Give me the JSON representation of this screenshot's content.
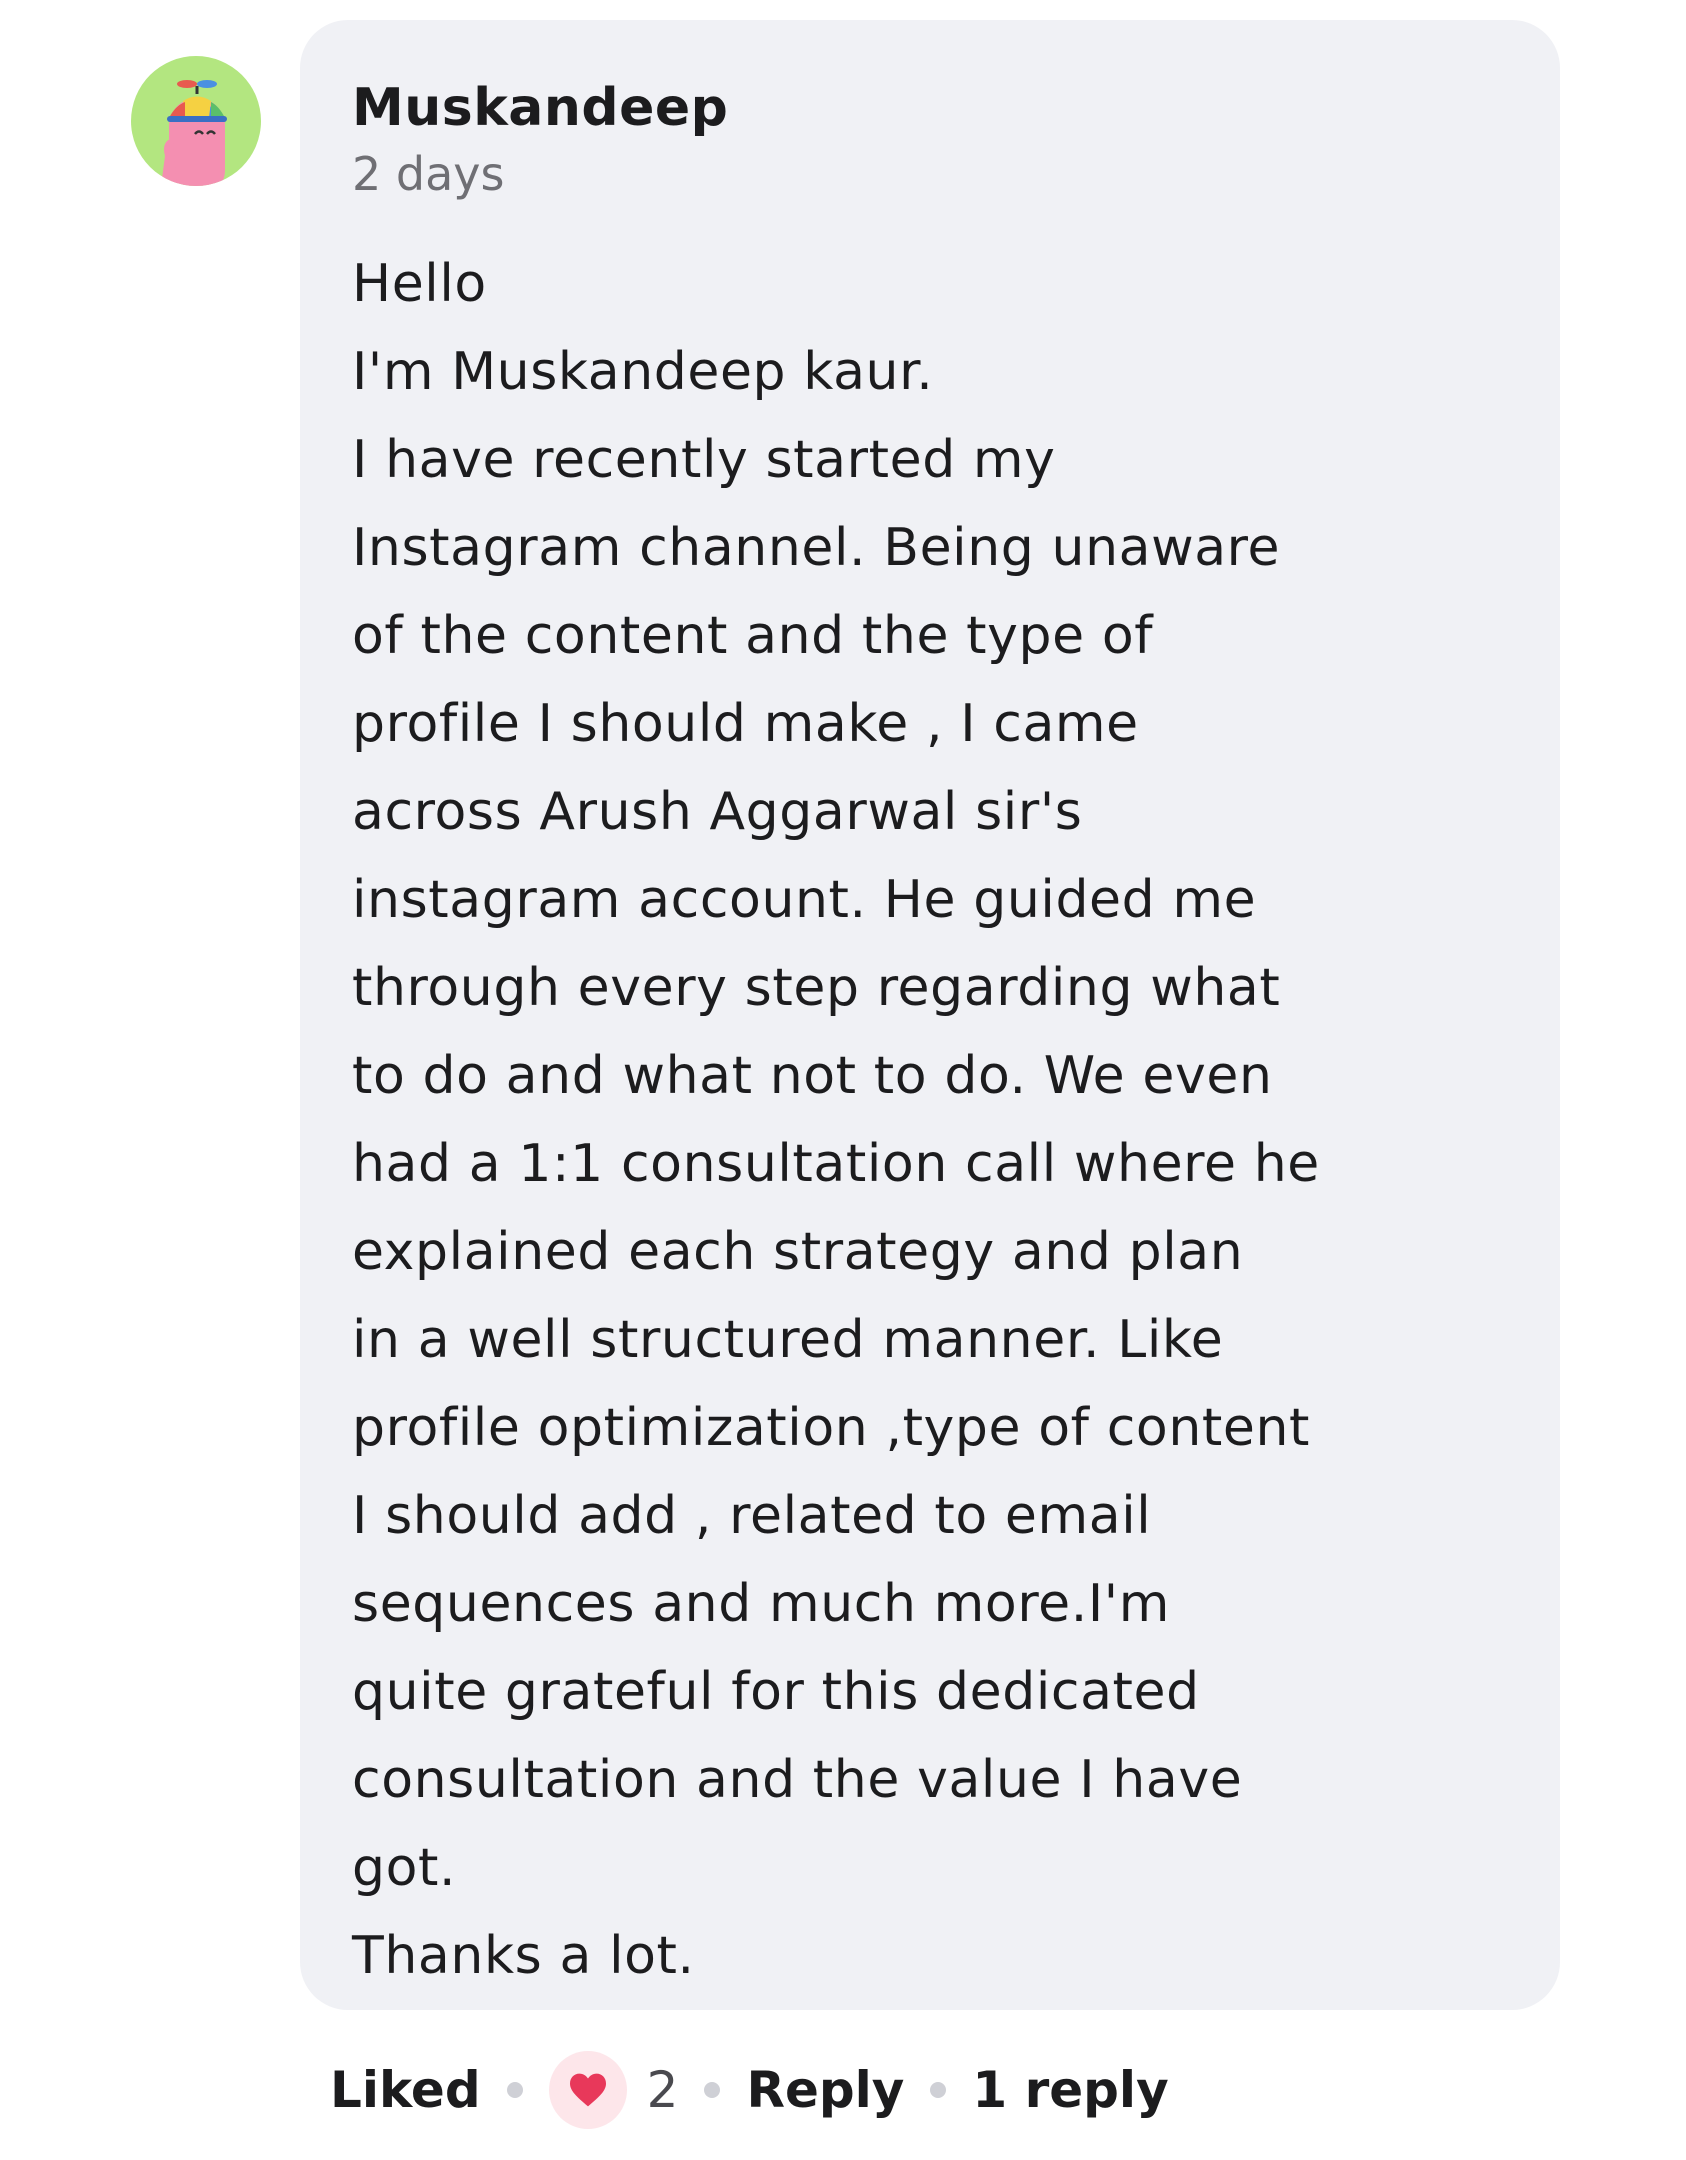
{
  "comment": {
    "author": "Muskandeep",
    "time": "2 days",
    "lines": [
      "Hello",
      "I'm Muskandeep kaur.",
      "I have recently started my",
      "Instagram channel. Being unaware",
      "of the content and the type of",
      "profile I should make , I came",
      "across Arush Aggarwal sir's",
      "instagram account. He guided me",
      "through every step regarding what",
      "to do and what not to do. We even",
      "had a 1:1 consultation call where he",
      "explained each strategy and plan",
      "in a well structured manner. Like",
      "profile optimization ,type of content",
      "I should add , related to email",
      "sequences and much more.I'm",
      "quite grateful for this dedicated",
      "consultation and the value I have",
      "got.",
      "Thanks a lot."
    ]
  },
  "actions": {
    "liked_label": "Liked",
    "like_count": "2",
    "reply_label": "Reply",
    "replies_label": "1 reply"
  },
  "colors": {
    "bubble_bg": "#f0f1f5",
    "avatar_bg": "#b3e680",
    "heart": "#e8385a",
    "heart_bg": "#fde6ea"
  },
  "icons": {
    "avatar": "cartoon-propeller-hat-avatar",
    "like": "heart-icon"
  }
}
